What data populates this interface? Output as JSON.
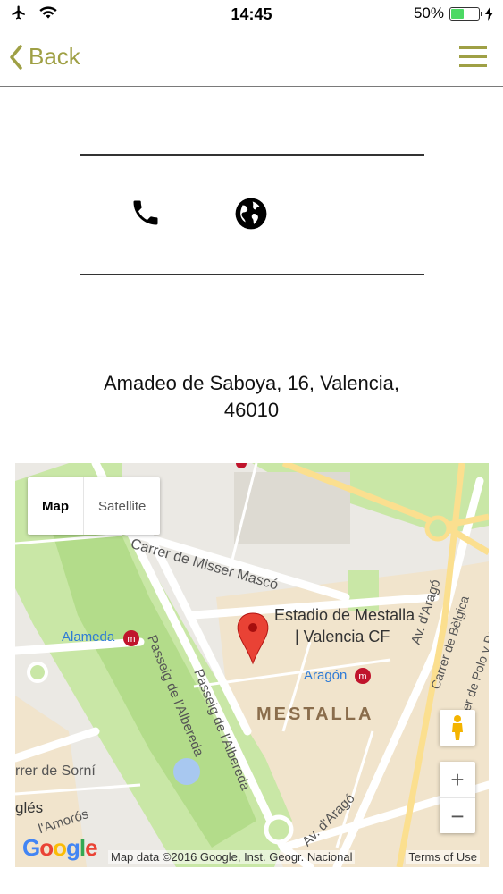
{
  "status_bar": {
    "time": "14:45",
    "battery_percent": "50%",
    "battery_level": 0.5
  },
  "nav": {
    "back_label": "Back",
    "accent_color": "#9fa045"
  },
  "contact": {
    "phone_icon": "phone-icon",
    "web_icon": "globe-icon"
  },
  "address": {
    "line1": "Amadeo de Saboya, 16, Valencia,",
    "line2": "46010"
  },
  "map": {
    "type_map": "Map",
    "type_satellite": "Satellite",
    "zoom_in": "+",
    "zoom_out": "−",
    "attribution": "Map data ©2016 Google, Inst. Geogr. Nacional",
    "terms": "Terms of Use",
    "logo": "Google",
    "labels": {
      "misser_masco": "Carrer de Misser Mascó",
      "estadio": "Estadio de Mestalla",
      "valencia_cf": "| Valencia CF",
      "alameda": "Alameda",
      "aragon_metro": "Aragón",
      "mestalla": "MESTALLA",
      "passeig1": "Passeig de l'Albereda",
      "passeig2": "Passeig de l'Albereda",
      "av_arago_top": "Av. d'Aragó",
      "av_arago_bottom": "Av. d'Aragó",
      "belgica": "Carrer de Bèlgica",
      "polo": "Carrer de Polo y Peyrolón",
      "sorni": "rrer de Sorní",
      "angles": "glés",
      "amoros": "l'Amorós"
    }
  }
}
